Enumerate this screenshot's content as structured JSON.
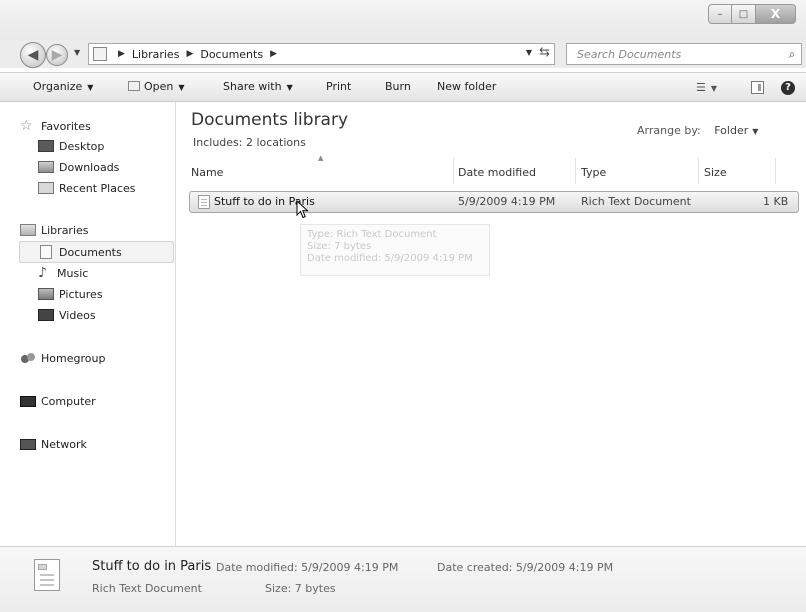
{
  "window": {
    "min_glyph": "–",
    "max_glyph": "□",
    "close_glyph": "X"
  },
  "address": {
    "crumbs": [
      "Libraries",
      "Documents"
    ],
    "search_placeholder": "Search Documents"
  },
  "toolbar": {
    "organize": "Organize",
    "open": "Open",
    "share_with": "Share with",
    "print": "Print",
    "burn": "Burn",
    "new_folder": "New folder"
  },
  "nav": {
    "favorites": "Favorites",
    "desktop": "Desktop",
    "downloads": "Downloads",
    "recent_places": "Recent Places",
    "libraries": "Libraries",
    "documents": "Documents",
    "music": "Music",
    "pictures": "Pictures",
    "videos": "Videos",
    "homegroup": "Homegroup",
    "computer": "Computer",
    "network": "Network"
  },
  "library": {
    "title": "Documents library",
    "includes": "Includes:  2 locations",
    "arrange_label": "Arrange by:",
    "arrange_value": "Folder"
  },
  "columns": {
    "name": "Name",
    "date_modified": "Date modified",
    "type": "Type",
    "size": "Size"
  },
  "files": [
    {
      "name": "Stuff to do in Paris",
      "date_modified": "5/9/2009 4:19 PM",
      "type": "Rich Text Document",
      "size": "1 KB"
    }
  ],
  "tooltip": {
    "type": "Type: Rich Text Document",
    "size": "Size: 7 bytes",
    "date": "Date modified: 5/9/2009 4:19 PM"
  },
  "details": {
    "name": "Stuff to do in Paris",
    "type": "Rich Text Document",
    "date_modified": "Date modified: 5/9/2009 4:19 PM",
    "size": "Size: 7 bytes",
    "date_created": "Date created: 5/9/2009 4:19 PM"
  }
}
